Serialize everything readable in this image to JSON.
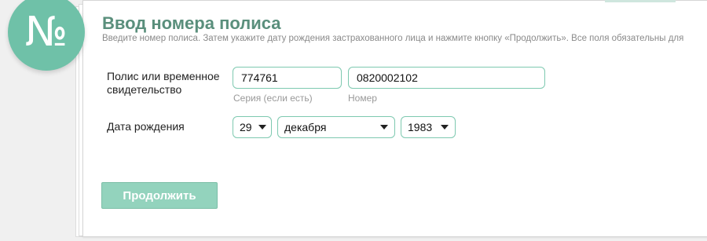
{
  "icon": {
    "name": "numero-icon",
    "glyph": "№",
    "color": "#6fc1a8"
  },
  "header": {
    "title": "Ввод номера полиса",
    "subtitle": "Введите номер полиса. Затем укажите дату рождения застрахованного лица и нажмите кнопку «Продолжить». Все поля обязательны для"
  },
  "form": {
    "policy": {
      "label_line1": "Полис или временное",
      "label_line2": "свидетельство",
      "series_value": "774761",
      "series_hint": "Серия (если есть)",
      "number_value": "0820002102",
      "number_hint": "Номер"
    },
    "birth_date": {
      "label": "Дата рождения",
      "day": "29",
      "month": "декабря",
      "year": "1983"
    },
    "submit_label": "Продолжить"
  },
  "colors": {
    "accent": "#6fc1a8",
    "title": "#5a8f7c",
    "input_border": "#7ec9b0",
    "button_bg": "#93d3bd"
  }
}
